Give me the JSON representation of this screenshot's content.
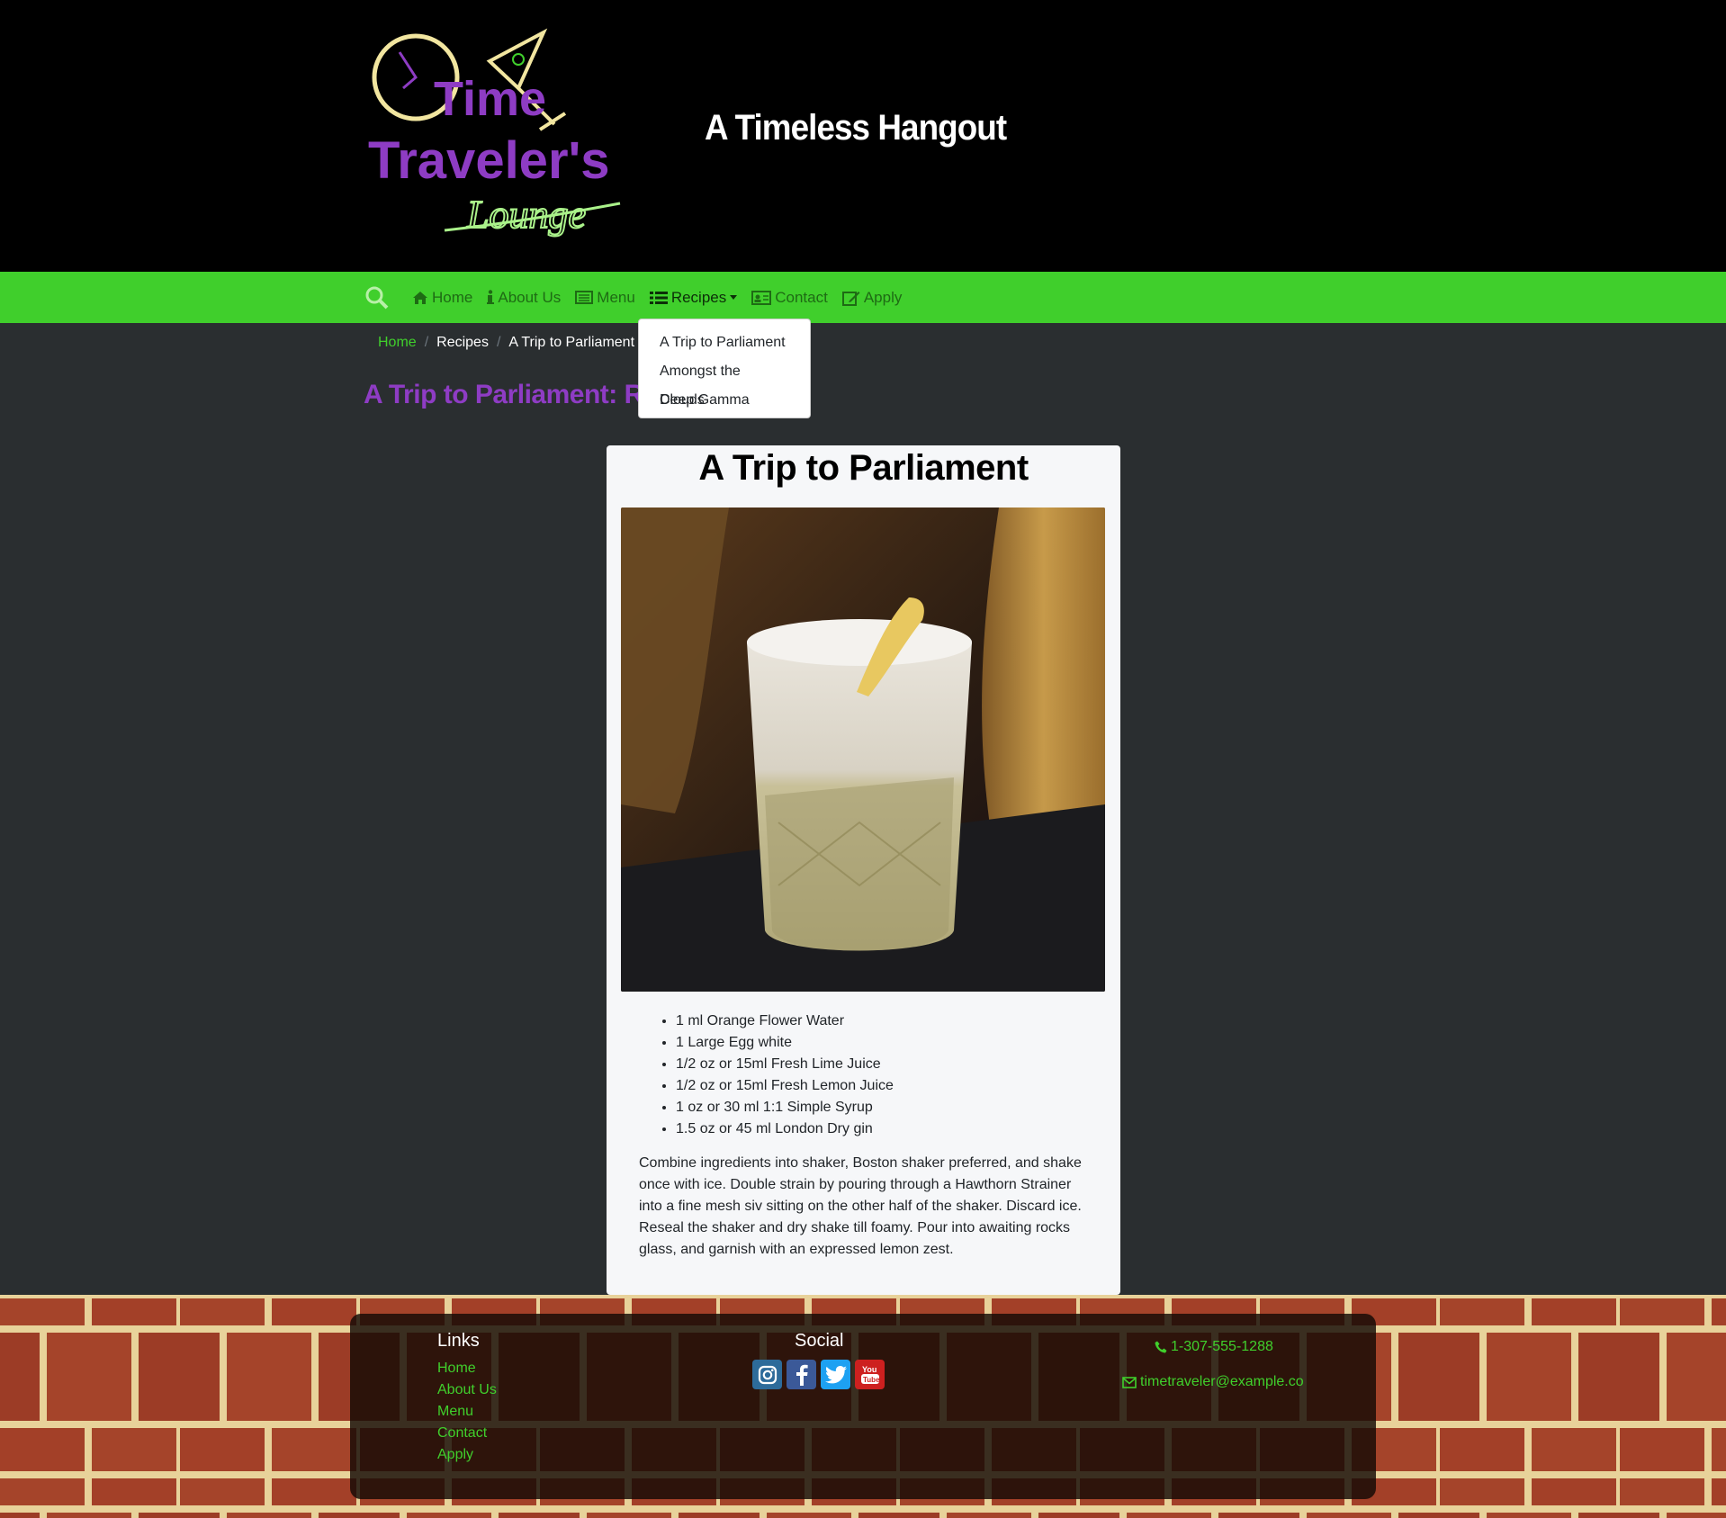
{
  "header": {
    "logo_text": [
      "Time",
      "Traveler's",
      "Lounge"
    ],
    "tagline": "A Timeless Hangout"
  },
  "nav": {
    "items": [
      {
        "label": "Home",
        "icon": "home-icon"
      },
      {
        "label": "About Us",
        "icon": "info-icon"
      },
      {
        "label": "Menu",
        "icon": "menu-list-icon"
      },
      {
        "label": "Recipes",
        "icon": "list-icon"
      },
      {
        "label": "Contact",
        "icon": "contact-card-icon"
      },
      {
        "label": "Apply",
        "icon": "edit-icon"
      }
    ],
    "dropdown": [
      "A Trip to Parliament",
      "Amongst the Clouds",
      "Deep Gamma"
    ]
  },
  "breadcrumb": [
    "Home",
    "Recipes",
    "A Trip to Parliament"
  ],
  "page_heading": "A Trip to Parliament: Recipe",
  "card": {
    "title": "A Trip to Parliament",
    "ingredients": [
      "1 ml Orange Flower Water",
      "1 Large Egg white",
      "1/2 oz or 15ml Fresh Lime Juice",
      "1/2 oz or 15ml Fresh Lemon Juice",
      "1 oz or 30 ml 1:1 Simple Syrup",
      "1.5 oz or 45 ml London Dry gin"
    ],
    "instructions": "Combine ingredients into shaker, Boston shaker preferred, and shake once with ice. Double strain by pouring through a Hawthorn Strainer into a fine mesh siv sitting on the other half of the shaker. Discard ice. Reseal the shaker and dry shake till foamy. Pour into awaiting rocks glass, and garnish with an expressed lemon zest."
  },
  "footer": {
    "links_heading": "Links",
    "links": [
      "Home",
      "About Us",
      "Menu",
      "Contact",
      "Apply"
    ],
    "social_heading": "Social",
    "social": [
      "instagram-icon",
      "facebook-icon",
      "twitter-icon",
      "youtube-icon"
    ],
    "phone": "1-307-555-1288",
    "email": "timetraveler@example.co"
  },
  "colors": {
    "nav_green": "#40cf2c",
    "heading_purple": "#8e3cc4",
    "header_black": "#000000"
  }
}
